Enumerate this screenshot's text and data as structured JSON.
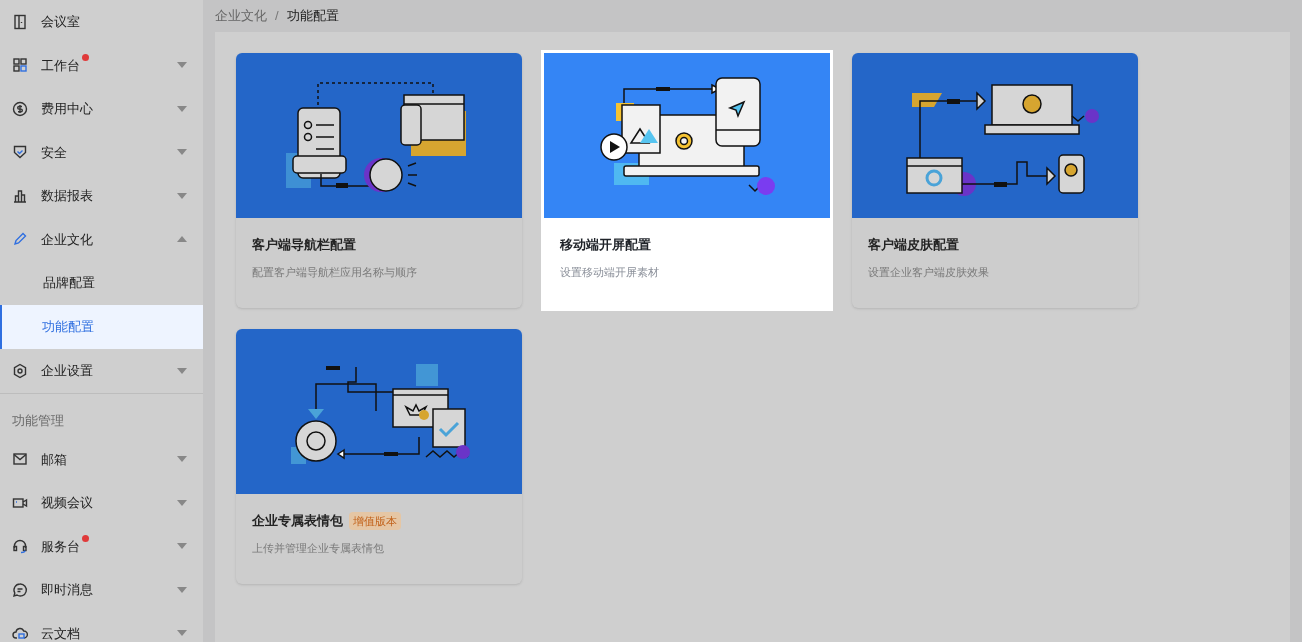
{
  "sidebar": {
    "items": [
      {
        "kind": "link",
        "label": "会议室",
        "dot": false
      },
      {
        "kind": "menu",
        "label": "工作台",
        "dot": true,
        "expanded": false
      },
      {
        "kind": "menu",
        "label": "费用中心",
        "dot": false,
        "expanded": false
      },
      {
        "kind": "menu",
        "label": "安全",
        "dot": false,
        "expanded": false
      },
      {
        "kind": "menu",
        "label": "数据报表",
        "dot": false,
        "expanded": false
      },
      {
        "kind": "menu",
        "label": "企业文化",
        "dot": false,
        "expanded": true,
        "children": [
          {
            "label": "品牌配置",
            "selected": false
          },
          {
            "label": "功能配置",
            "selected": true
          }
        ]
      },
      {
        "kind": "menu",
        "label": "企业设置",
        "dot": false,
        "expanded": false
      },
      {
        "kind": "section",
        "label": "功能管理"
      },
      {
        "kind": "menu",
        "label": "邮箱",
        "dot": false,
        "expanded": false
      },
      {
        "kind": "menu",
        "label": "视频会议",
        "dot": false,
        "expanded": false
      },
      {
        "kind": "menu",
        "label": "服务台",
        "dot": true,
        "expanded": false
      },
      {
        "kind": "menu",
        "label": "即时消息",
        "dot": false,
        "expanded": false
      },
      {
        "kind": "menu",
        "label": "云文档",
        "dot": false,
        "expanded": false
      }
    ]
  },
  "breadcrumb": {
    "items": [
      "企业文化",
      "功能配置"
    ],
    "separator": "/"
  },
  "cards": [
    {
      "title": "客户端导航栏配置",
      "description": "配置客户端导航栏应用名称与顺序",
      "highlighted": false
    },
    {
      "title": "移动端开屏配置",
      "description": "设置移动端开屏素材",
      "highlighted": true
    },
    {
      "title": "客户端皮肤配置",
      "description": "设置企业客户端皮肤效果",
      "highlighted": false
    },
    {
      "title": "企业专属表情包",
      "badge": "增值版本",
      "description": "上传并管理企业专属表情包",
      "highlighted": false
    }
  ]
}
